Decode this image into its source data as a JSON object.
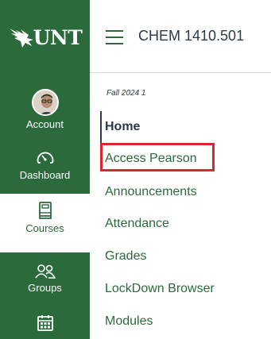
{
  "brand": {
    "logo_text": "UNT",
    "colors": {
      "green": "#2b6a3b",
      "text": "#2d3b45",
      "highlight": "#e0242b"
    }
  },
  "global_nav": [
    {
      "label": "Account",
      "icon": "avatar"
    },
    {
      "label": "Dashboard",
      "icon": "dashboard-gauge-icon"
    },
    {
      "label": "Courses",
      "icon": "courses-book-icon",
      "active": true
    },
    {
      "label": "Groups",
      "icon": "groups-people-icon"
    },
    {
      "label": "",
      "icon": "calendar-icon"
    }
  ],
  "header": {
    "menu_icon": "hamburger-menu-icon",
    "course_title": "CHEM 1410.501"
  },
  "course_nav": {
    "term": "Fall 2024 1",
    "items": [
      {
        "label": "Home",
        "active": true
      },
      {
        "label": "Access Pearson",
        "highlighted": true
      },
      {
        "label": "Announcements"
      },
      {
        "label": "Attendance"
      },
      {
        "label": "Grades"
      },
      {
        "label": "LockDown Browser"
      },
      {
        "label": "Modules"
      }
    ]
  }
}
